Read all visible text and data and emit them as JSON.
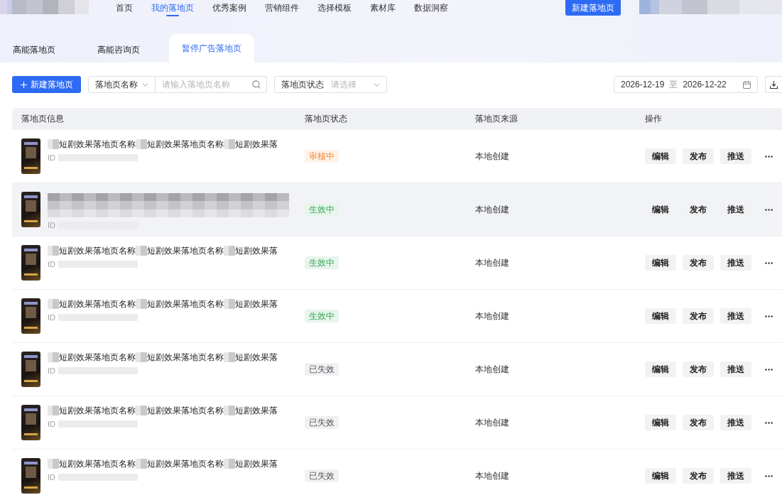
{
  "top_nav": {
    "items": [
      {
        "label": "首页",
        "selected": false
      },
      {
        "label": "我的落地页",
        "selected": true
      },
      {
        "label": "优秀案例",
        "selected": false
      },
      {
        "label": "营销组件",
        "selected": false
      },
      {
        "label": "选择模板",
        "selected": false
      },
      {
        "label": "素材库",
        "selected": false
      },
      {
        "label": "数据洞察",
        "selected": false
      }
    ],
    "create_button": "新建落地页"
  },
  "tabs": [
    {
      "label": "高能落地页",
      "selected": false
    },
    {
      "label": "高能咨询页",
      "selected": false
    },
    {
      "label": "暂停广告落地页",
      "selected": true
    }
  ],
  "toolbar": {
    "create_button": "新建落地页",
    "name_filter": {
      "field": "落地页名称",
      "placeholder": "请输入落地页名称"
    },
    "status_filter": {
      "label": "落地页状态",
      "placeholder": "请选择"
    },
    "date_range": {
      "start": "2026-12-19",
      "separator": "至",
      "end": "2026-12-22"
    }
  },
  "table": {
    "columns": [
      "落地页信息",
      "落地页状态",
      "落地页来源",
      "操作"
    ],
    "rows": [
      {
        "hovered": false,
        "title_parts": [
          {
            "kind": "blur"
          },
          {
            "kind": "text",
            "text": "短剧效果落地页名称"
          },
          {
            "kind": "blur"
          },
          {
            "kind": "text",
            "text": "短剧效果落地页名称"
          },
          {
            "kind": "blur"
          },
          {
            "kind": "text",
            "text": "短剧效果落"
          }
        ],
        "id_label": "ID",
        "status": {
          "kind": "reviewing",
          "text": "审核中"
        },
        "source": "本地创建",
        "actions": [
          "编辑",
          "发布",
          "推送"
        ]
      },
      {
        "hovered": true,
        "title_parts": [
          {
            "kind": "blur_lines"
          }
        ],
        "id_label": "ID",
        "status": {
          "kind": "active",
          "text": "生效中"
        },
        "source": "本地创建",
        "actions": [
          "编辑",
          "发布",
          "推送"
        ]
      },
      {
        "hovered": false,
        "title_parts": [
          {
            "kind": "blur"
          },
          {
            "kind": "text",
            "text": "短剧效果落地页名称"
          },
          {
            "kind": "blur"
          },
          {
            "kind": "text",
            "text": "短剧效果落地页名称"
          },
          {
            "kind": "blur"
          },
          {
            "kind": "text",
            "text": "短剧效果落"
          }
        ],
        "id_label": "ID",
        "status": {
          "kind": "active",
          "text": "生效中"
        },
        "source": "本地创建",
        "actions": [
          "编辑",
          "发布",
          "推送"
        ]
      },
      {
        "hovered": false,
        "title_parts": [
          {
            "kind": "blur"
          },
          {
            "kind": "text",
            "text": "短剧效果落地页名称"
          },
          {
            "kind": "blur"
          },
          {
            "kind": "text",
            "text": "短剧效果落地页名称"
          },
          {
            "kind": "blur"
          },
          {
            "kind": "text",
            "text": "短剧效果落"
          }
        ],
        "id_label": "ID",
        "status": {
          "kind": "active",
          "text": "生效中"
        },
        "source": "本地创建",
        "actions": [
          "编辑",
          "发布",
          "推送"
        ]
      },
      {
        "hovered": false,
        "title_parts": [
          {
            "kind": "blur"
          },
          {
            "kind": "text",
            "text": "短剧效果落地页名称"
          },
          {
            "kind": "blur"
          },
          {
            "kind": "text",
            "text": "短剧效果落地页名称"
          },
          {
            "kind": "blur"
          },
          {
            "kind": "text",
            "text": "短剧效果落"
          }
        ],
        "id_label": "ID",
        "status": {
          "kind": "expired",
          "text": "已失效"
        },
        "source": "本地创建",
        "actions": [
          "编辑",
          "发布",
          "推送"
        ]
      },
      {
        "hovered": false,
        "title_parts": [
          {
            "kind": "blur"
          },
          {
            "kind": "text",
            "text": "短剧效果落地页名称"
          },
          {
            "kind": "blur"
          },
          {
            "kind": "text",
            "text": "短剧效果落地页名称"
          },
          {
            "kind": "blur"
          },
          {
            "kind": "text",
            "text": "短剧效果落"
          }
        ],
        "id_label": "ID",
        "status": {
          "kind": "expired",
          "text": "已失效"
        },
        "source": "本地创建",
        "actions": [
          "编辑",
          "发布",
          "推送"
        ]
      },
      {
        "hovered": false,
        "title_parts": [
          {
            "kind": "blur"
          },
          {
            "kind": "text",
            "text": "短剧效果落地页名称"
          },
          {
            "kind": "blur"
          },
          {
            "kind": "text",
            "text": "短剧效果落地页名称"
          },
          {
            "kind": "blur"
          },
          {
            "kind": "text",
            "text": "短剧效果落"
          }
        ],
        "id_label": "ID",
        "status": {
          "kind": "expired",
          "text": "已失效"
        },
        "source": "本地创建",
        "actions": [
          "编辑",
          "发布",
          "推送"
        ]
      }
    ]
  }
}
